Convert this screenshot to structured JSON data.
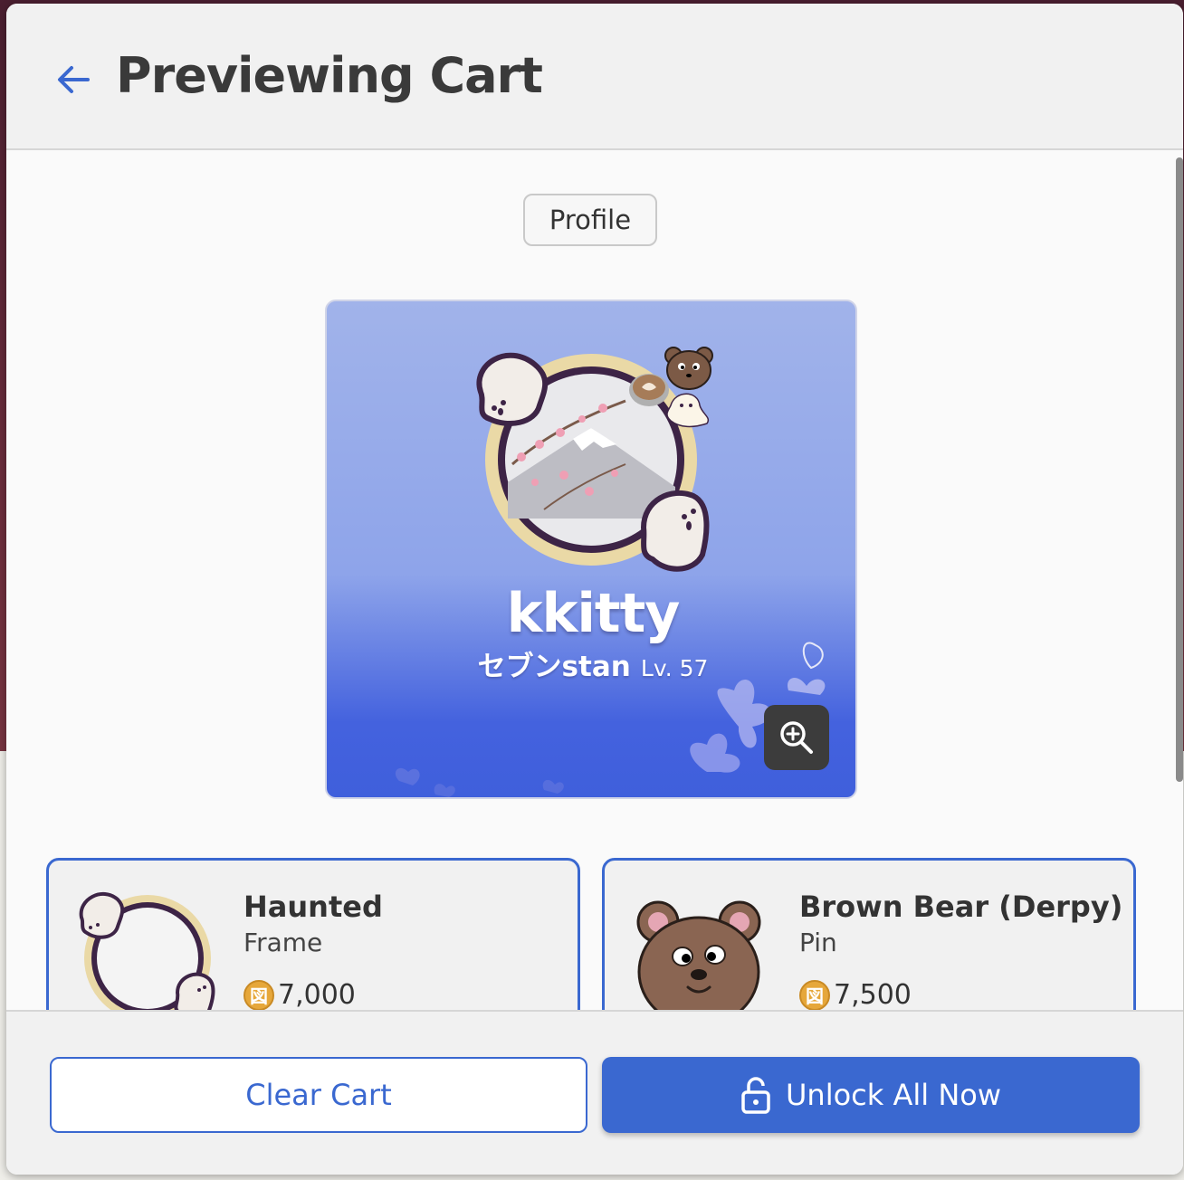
{
  "header": {
    "title": "Previewing Cart",
    "back_icon": "arrow-left-icon"
  },
  "tab": {
    "label": "Profile"
  },
  "preview": {
    "display_name": "kkitty",
    "subtitle": "セブンstan",
    "level": "Lv. 57",
    "zoom_icon": "zoom-in-icon"
  },
  "cart_items": [
    {
      "name": "Haunted",
      "type": "Frame",
      "price": "7,000",
      "currency_icon": "coin-icon"
    },
    {
      "name": "Brown Bear (Derpy)",
      "type": "Pin",
      "price": "7,500",
      "currency_icon": "coin-icon"
    }
  ],
  "footer": {
    "clear_label": "Clear Cart",
    "unlock_label": "Unlock All Now",
    "unlock_icon": "lock-icon"
  },
  "colors": {
    "accent": "#3a68d0",
    "coin": "#e6a73a",
    "card_gradient_top": "#a1b3ea",
    "card_gradient_bottom": "#3f5fdc"
  }
}
